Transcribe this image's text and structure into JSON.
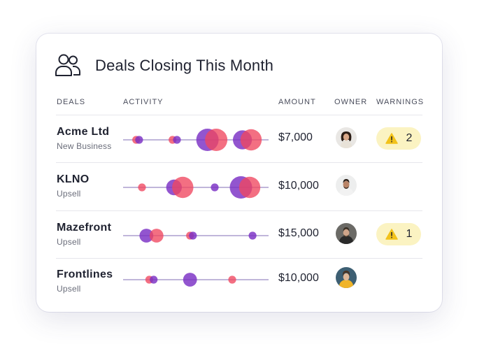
{
  "header": {
    "title": "Deals Closing This Month",
    "icon": "users-icon"
  },
  "columns": {
    "deals": "DEALS",
    "activity": "ACTIVITY",
    "amount": "AMOUNT",
    "owner": "OWNER",
    "warnings": "WARNINGS"
  },
  "colors": {
    "pink": "#f0465f",
    "purple": "#7a2fc4",
    "warning_bg": "#fbf3c2",
    "warning_icon": "#f2c21b"
  },
  "rows": [
    {
      "name": "Acme Ltd",
      "type": "New Business",
      "amount": "$7,000",
      "owner": "owner-avatar-1",
      "warnings": "2",
      "activity": [
        {
          "pos": 0.09,
          "size": 0.35,
          "color": "pink"
        },
        {
          "pos": 0.11,
          "size": 0.35,
          "color": "purple"
        },
        {
          "pos": 0.34,
          "size": 0.35,
          "color": "pink"
        },
        {
          "pos": 0.37,
          "size": 0.35,
          "color": "purple"
        },
        {
          "pos": 0.58,
          "size": 1.0,
          "color": "purple"
        },
        {
          "pos": 0.64,
          "size": 1.0,
          "color": "pink"
        },
        {
          "pos": 0.82,
          "size": 0.85,
          "color": "purple"
        },
        {
          "pos": 0.88,
          "size": 0.95,
          "color": "pink"
        }
      ]
    },
    {
      "name": "KLNO",
      "type": "Upsell",
      "amount": "$10,000",
      "owner": "owner-avatar-2",
      "warnings": "",
      "activity": [
        {
          "pos": 0.13,
          "size": 0.35,
          "color": "pink"
        },
        {
          "pos": 0.35,
          "size": 0.7,
          "color": "purple"
        },
        {
          "pos": 0.41,
          "size": 0.95,
          "color": "pink"
        },
        {
          "pos": 0.63,
          "size": 0.35,
          "color": "purple"
        },
        {
          "pos": 0.81,
          "size": 1.0,
          "color": "purple"
        },
        {
          "pos": 0.87,
          "size": 0.95,
          "color": "pink"
        }
      ]
    },
    {
      "name": "Mazefront",
      "type": "Upsell",
      "amount": "$15,000",
      "owner": "owner-avatar-3",
      "warnings": "1",
      "activity": [
        {
          "pos": 0.16,
          "size": 0.62,
          "color": "purple"
        },
        {
          "pos": 0.23,
          "size": 0.62,
          "color": "pink"
        },
        {
          "pos": 0.46,
          "size": 0.35,
          "color": "pink"
        },
        {
          "pos": 0.48,
          "size": 0.35,
          "color": "purple"
        },
        {
          "pos": 0.89,
          "size": 0.35,
          "color": "purple"
        }
      ]
    },
    {
      "name": "Frontlines",
      "type": "Upsell",
      "amount": "$10,000",
      "owner": "owner-avatar-4",
      "warnings": "",
      "activity": [
        {
          "pos": 0.18,
          "size": 0.35,
          "color": "pink"
        },
        {
          "pos": 0.21,
          "size": 0.35,
          "color": "purple"
        },
        {
          "pos": 0.46,
          "size": 0.62,
          "color": "purple"
        },
        {
          "pos": 0.75,
          "size": 0.35,
          "color": "pink"
        }
      ]
    }
  ]
}
